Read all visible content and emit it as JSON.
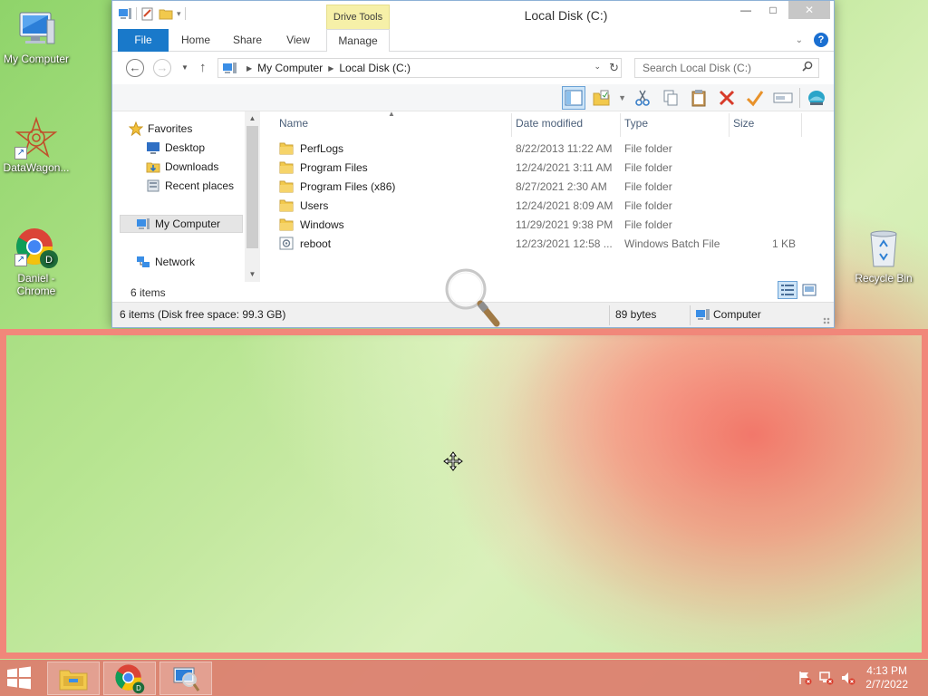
{
  "desktop": {
    "icons": [
      {
        "label": "My Computer",
        "icon": "my-computer-icon"
      },
      {
        "label": "DataWagon...",
        "icon": "datawagon-icon"
      },
      {
        "label": "Daniel - Chrome",
        "icon": "chrome-icon",
        "badge": "D"
      },
      {
        "label": "Recycle Bin",
        "icon": "recycle-bin-icon"
      }
    ]
  },
  "window": {
    "title": "Local Disk (C:)",
    "context_group": "Drive Tools",
    "tabs": [
      "File",
      "Home",
      "Share",
      "View",
      "Manage"
    ],
    "address": {
      "crumbs": [
        "My Computer",
        "Local Disk (C:)"
      ]
    },
    "search": {
      "placeholder": "Search Local Disk (C:)"
    },
    "toolbar_icons": [
      "preview-pane-icon",
      "new-folder-icon",
      "cut-icon",
      "copy-icon",
      "paste-icon",
      "delete-icon",
      "checkmark-icon",
      "rename-icon",
      "network-globe-icon"
    ],
    "nav": {
      "favorites": "Favorites",
      "items": [
        "Desktop",
        "Downloads",
        "Recent places"
      ],
      "my_computer": "My Computer",
      "network": "Network"
    },
    "columns": {
      "name": "Name",
      "date": "Date modified",
      "type": "Type",
      "size": "Size"
    },
    "files": [
      {
        "name": "PerfLogs",
        "date": "8/22/2013 11:22 AM",
        "type": "File folder",
        "size": "",
        "kind": "folder"
      },
      {
        "name": "Program Files",
        "date": "12/24/2021 3:11 AM",
        "type": "File folder",
        "size": "",
        "kind": "folder"
      },
      {
        "name": "Program Files (x86)",
        "date": "8/27/2021 2:30 AM",
        "type": "File folder",
        "size": "",
        "kind": "folder"
      },
      {
        "name": "Users",
        "date": "12/24/2021 8:09 AM",
        "type": "File folder",
        "size": "",
        "kind": "folder"
      },
      {
        "name": "Windows",
        "date": "11/29/2021 9:38 PM",
        "type": "File folder",
        "size": "",
        "kind": "folder"
      },
      {
        "name": "reboot",
        "date": "12/23/2021 12:58 ...",
        "type": "Windows Batch File",
        "size": "1 KB",
        "kind": "batch"
      }
    ],
    "items_count": "6 items",
    "status": {
      "left": "6 items (Disk free space: 99.3 GB)",
      "middle": "89 bytes",
      "right": "Computer"
    }
  },
  "taskbar": {
    "apps": [
      "file-explorer-icon",
      "chrome-icon",
      "magnifier-app-icon"
    ],
    "clock": {
      "time": "4:13 PM",
      "date": "2/7/2022"
    }
  },
  "colors": {
    "accent": "#1979ca",
    "region_border": "#f1877a",
    "taskbar": "#dc7d6e",
    "context_tab": "#f6f0a8"
  }
}
